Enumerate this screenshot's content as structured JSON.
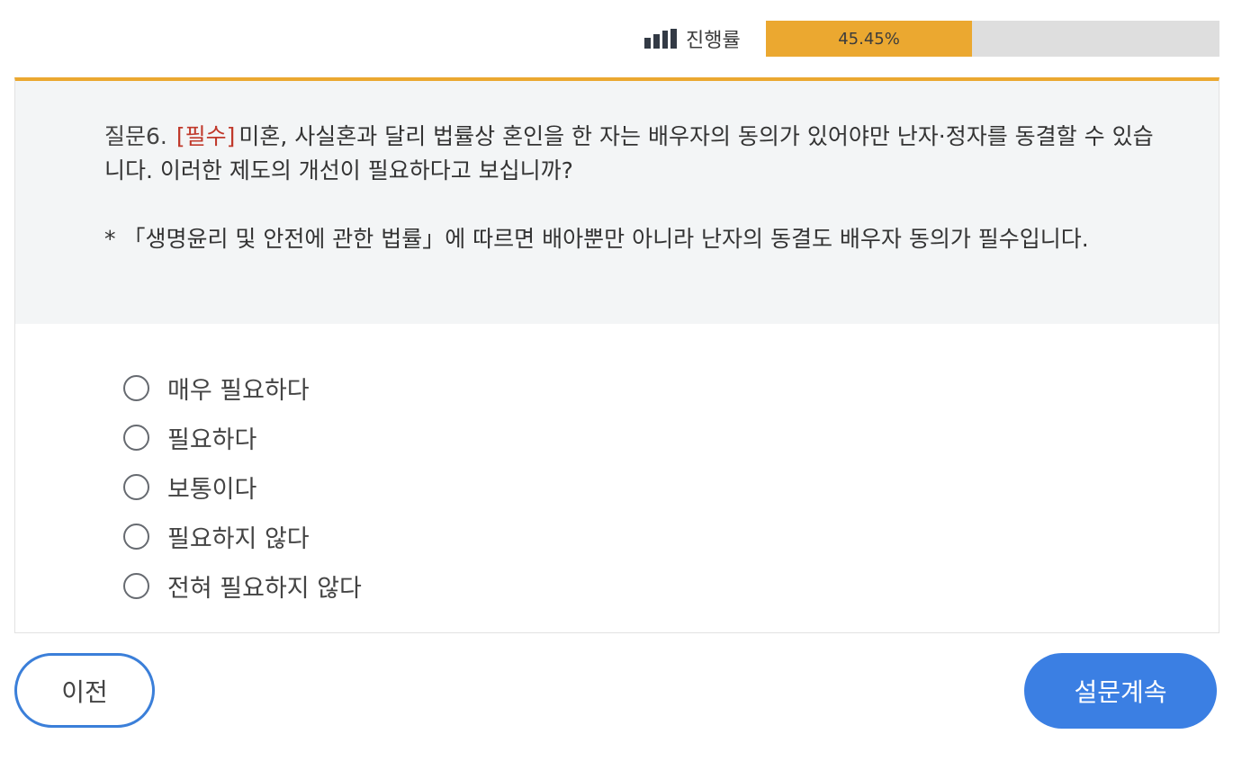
{
  "progress": {
    "label": "진행률",
    "value_text": "45.45%",
    "value_percent": 45.45,
    "icon": "bar-chart-icon",
    "fill_color": "#eba830",
    "track_color": "#dedede"
  },
  "question": {
    "number": "질문6.",
    "required_tag": "[필수]",
    "text": "미혼, 사실혼과 달리 법률상 혼인을 한 자는 배우자의 동의가 있어야만 난자·정자를 동결할 수 있습니다. 이러한 제도의 개선이 필요하다고 보십니까?",
    "note": "* 「생명윤리 및 안전에 관한 법률」에 따르면 배아뿐만 아니라 난자의 동결도 배우자 동의가 필수입니다.",
    "accent_color": "#eba830",
    "required_color": "#c0392b"
  },
  "options": [
    {
      "label": "매우 필요하다",
      "selected": false
    },
    {
      "label": "필요하다",
      "selected": false
    },
    {
      "label": "보통이다",
      "selected": false
    },
    {
      "label": "필요하지 않다",
      "selected": false
    },
    {
      "label": "전혀 필요하지 않다",
      "selected": false
    }
  ],
  "buttons": {
    "prev_label": "이전",
    "next_label": "설문계속",
    "primary_color": "#3b7fe3"
  }
}
